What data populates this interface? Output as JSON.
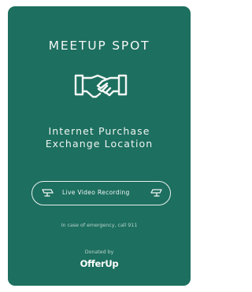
{
  "sign": {
    "background_color": "#1d6f5f",
    "title": "MEETUP SPOT",
    "icon": "handshake-icon",
    "subtitle_line1": "Internet Purchase",
    "subtitle_line2": "Exchange Location",
    "recording_label": "Live Video Recording",
    "recording_icons": [
      "camera-icon",
      "camera-icon"
    ],
    "emergency_text": "In case of emergency, call 911",
    "donated_text": "Donated by",
    "brand": "OfferUp"
  }
}
